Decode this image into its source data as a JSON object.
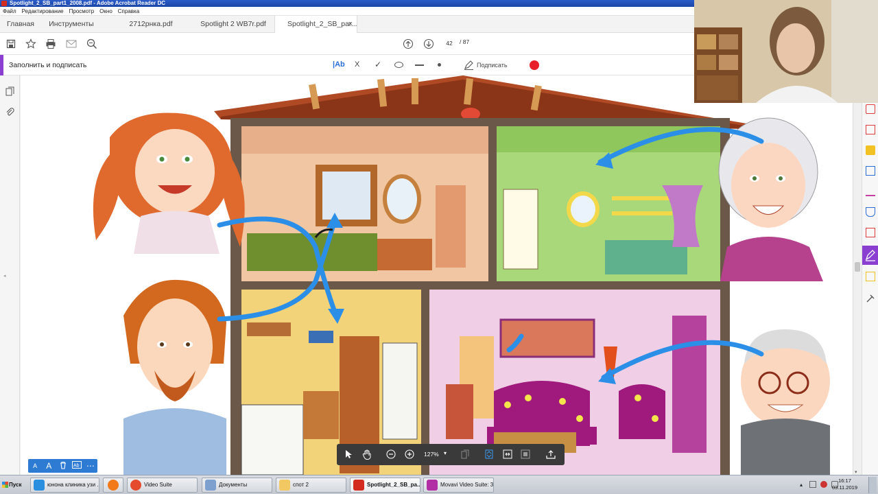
{
  "window": {
    "title": "Spotlight_2_SB_part1_2008.pdf - Adobe Acrobat Reader DC"
  },
  "menu": [
    "Файл",
    "Редактирование",
    "Просмотр",
    "Окно",
    "Справка"
  ],
  "tabs": {
    "home": "Главная",
    "tools": "Инструменты",
    "docs": [
      {
        "label": "2712рнка.pdf"
      },
      {
        "label": "Spotlight 2 WB7r.pdf"
      },
      {
        "label": "Spotlight_2_SB_par...",
        "active": true
      }
    ],
    "close_glyph": "×"
  },
  "toolbar": {
    "current_page": "42",
    "total_pages": "/  87"
  },
  "fill_sign": {
    "title": "Заполнить и подписать",
    "text_tool": "|Ab",
    "cross": "X",
    "check": "✓",
    "sign": "Подписать",
    "record_color": "#e8202a"
  },
  "text_tools": {
    "small_a": "A",
    "big_a": "A",
    "more": "⋯"
  },
  "zoom_bar": {
    "zoom": "127%",
    "dropdown": "▾"
  },
  "taskbar": {
    "start": "Пуск",
    "items": [
      {
        "label": "юнона клиника узи ...",
        "color": "#2b8fe0"
      },
      {
        "label": "",
        "color": "#f27a1a"
      },
      {
        "label": "Video Suite",
        "color": "#e64a2e"
      },
      {
        "label": "Документы",
        "color": "#7da0cf"
      },
      {
        "label": "спот 2",
        "color": "#f1c861"
      },
      {
        "label": "Spotlight_2_SB_pa...",
        "color": "#d42b20",
        "active": true
      },
      {
        "label": "Movavi Video Suite: 3...",
        "color": "#b22ea5"
      }
    ],
    "time": "16:17",
    "date": "03.11.2019"
  },
  "colors": {
    "accent_purple": "#8a3fd0",
    "acrobat_blue": "#2e7bd4",
    "arrow_blue": "#2b8fe8"
  }
}
